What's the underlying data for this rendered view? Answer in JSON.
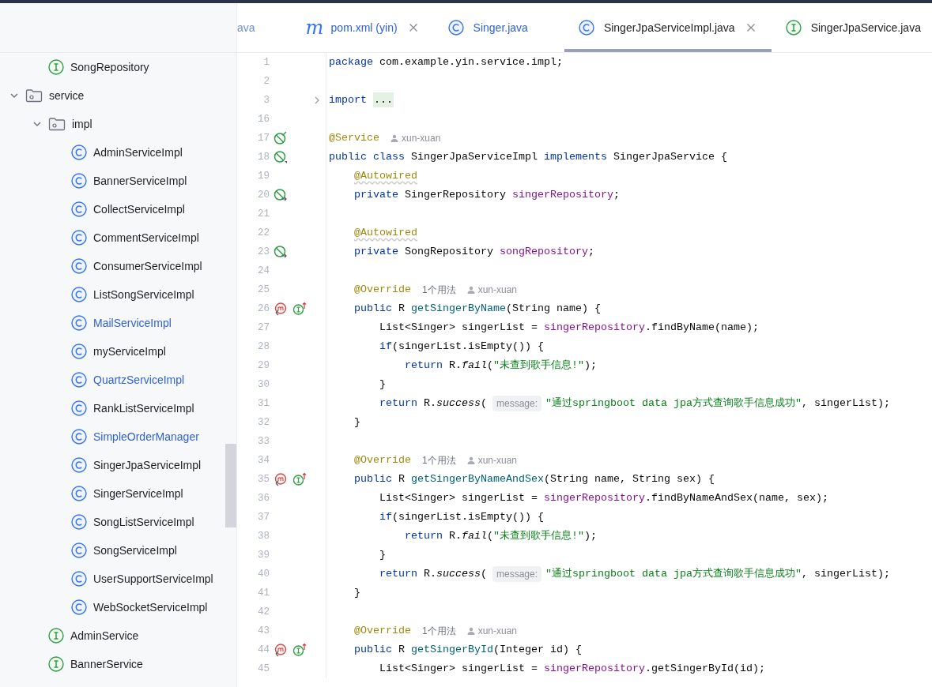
{
  "project_tree": {
    "partial_above": [
      {
        "label": "SongRepository",
        "kind": "interface",
        "modified": false
      }
    ],
    "items": [
      {
        "label": "service",
        "kind": "folder",
        "expanded": true,
        "modified": false,
        "children": [
          {
            "label": "impl",
            "kind": "folder",
            "expanded": true,
            "modified": false,
            "children": [
              {
                "label": "AdminServiceImpl",
                "kind": "class",
                "modified": false
              },
              {
                "label": "BannerServiceImpl",
                "kind": "class",
                "modified": false
              },
              {
                "label": "CollectServiceImpl",
                "kind": "class",
                "modified": false
              },
              {
                "label": "CommentServiceImpl",
                "kind": "class",
                "modified": false
              },
              {
                "label": "ConsumerServiceImpl",
                "kind": "class",
                "modified": false
              },
              {
                "label": "ListSongServiceImpl",
                "kind": "class",
                "modified": false
              },
              {
                "label": "MailServiceImpl",
                "kind": "class",
                "modified": true
              },
              {
                "label": "myServiceImpl",
                "kind": "class",
                "modified": false
              },
              {
                "label": "QuartzServiceImpl",
                "kind": "class",
                "modified": true
              },
              {
                "label": "RankListServiceImpl",
                "kind": "class",
                "modified": false
              },
              {
                "label": "SimpleOrderManager",
                "kind": "class",
                "modified": true
              },
              {
                "label": "SingerJpaServiceImpl",
                "kind": "class",
                "modified": false
              },
              {
                "label": "SingerServiceImpl",
                "kind": "class",
                "modified": false
              },
              {
                "label": "SongListServiceImpl",
                "kind": "class",
                "modified": false
              },
              {
                "label": "SongServiceImpl",
                "kind": "class",
                "modified": false
              },
              {
                "label": "UserSupportServiceImpl",
                "kind": "class",
                "modified": false
              },
              {
                "label": "WebSocketServiceImpl",
                "kind": "class",
                "modified": false
              }
            ]
          },
          {
            "label": "AdminService",
            "kind": "interface",
            "modified": false
          },
          {
            "label": "BannerService",
            "kind": "interface",
            "modified": false
          }
        ]
      }
    ]
  },
  "tabs": [
    {
      "label": "ava",
      "kind": "cut",
      "selected": false,
      "modified": true,
      "closable": false
    },
    {
      "label": "pom.xml (yin)",
      "kind": "maven",
      "glyph": "m",
      "selected": false,
      "modified": true,
      "closable": true
    },
    {
      "label": "Singer.java",
      "kind": "class",
      "selected": false,
      "modified": true,
      "closable": false
    },
    {
      "label": "SingerJpaServiceImpl.java",
      "kind": "class",
      "selected": true,
      "modified": false,
      "closable": true
    },
    {
      "label": "SingerJpaService.java",
      "kind": "interface",
      "selected": false,
      "modified": false,
      "closable": false
    }
  ],
  "editor": {
    "lines": [
      {
        "number": "1",
        "parts": [
          {
            "kind": "code",
            "tokens": [
              {
                "kw": "package"
              },
              {
                "plain": " com.example.yin.service.impl;"
              }
            ]
          }
        ]
      },
      {
        "number": "2"
      },
      {
        "number": "3",
        "fold": {
          "expanded": false
        },
        "parts": [
          {
            "kind": "code",
            "tokens": [
              {
                "kw": "import "
              },
              {
                "folded": "..."
              }
            ]
          }
        ]
      },
      {
        "number": "16"
      },
      {
        "number": "17",
        "markers": [
          {
            "kind": "bean"
          }
        ],
        "parts": [
          {
            "kind": "code",
            "tokens": [
              {
                "ann": "@Service"
              }
            ]
          },
          {
            "kind": "author",
            "text": "xun-xuan"
          }
        ]
      },
      {
        "number": "18",
        "markers": [
          {
            "kind": "bean-class"
          }
        ],
        "parts": [
          {
            "kind": "code",
            "tokens": [
              {
                "kw": "public class"
              },
              {
                "plain": " SingerJpaServiceImpl "
              },
              {
                "kw": "implements"
              },
              {
                "plain": " SingerJpaService {"
              }
            ]
          }
        ]
      },
      {
        "number": "19",
        "parts": [
          {
            "kind": "code",
            "tokens": [
              {
                "ann_warn": "    @Autowired"
              }
            ]
          }
        ]
      },
      {
        "number": "20",
        "markers": [
          {
            "kind": "inject"
          }
        ],
        "parts": [
          {
            "kind": "code",
            "tokens": [
              {
                "kw": "    private"
              },
              {
                "plain": " SingerRepository "
              },
              {
                "field": "singerRepository"
              },
              {
                "plain": ";"
              }
            ]
          }
        ]
      },
      {
        "number": "21"
      },
      {
        "number": "22",
        "parts": [
          {
            "kind": "code",
            "tokens": [
              {
                "ann_warn": "    @Autowired"
              }
            ]
          }
        ]
      },
      {
        "number": "23",
        "markers": [
          {
            "kind": "inject"
          }
        ],
        "parts": [
          {
            "kind": "code",
            "tokens": [
              {
                "kw": "    private"
              },
              {
                "plain": " SongRepository "
              },
              {
                "field": "songRepository"
              },
              {
                "plain": ";"
              }
            ]
          }
        ]
      },
      {
        "number": "24"
      },
      {
        "number": "25",
        "parts": [
          {
            "kind": "code",
            "tokens": [
              {
                "ann": "    @Override"
              }
            ]
          },
          {
            "kind": "usages",
            "text": "1个用法"
          },
          {
            "kind": "author",
            "text": "xun-xuan"
          }
        ]
      },
      {
        "number": "26",
        "markers": [
          {
            "kind": "method"
          },
          {
            "kind": "implements"
          }
        ],
        "parts": [
          {
            "kind": "code",
            "tokens": [
              {
                "kw": "    public"
              },
              {
                "plain": " R "
              },
              {
                "decl": "getSingerByName"
              },
              {
                "plain": "(String name) {"
              }
            ]
          }
        ]
      },
      {
        "number": "27",
        "parts": [
          {
            "kind": "code",
            "tokens": [
              {
                "plain": "        List<Singer> singerList = "
              },
              {
                "field": "singerRepository"
              },
              {
                "plain": ".findByName(name);"
              }
            ]
          }
        ]
      },
      {
        "number": "28",
        "parts": [
          {
            "kind": "code",
            "tokens": [
              {
                "kw": "        if"
              },
              {
                "plain": "(singerList.isEmpty()) {"
              }
            ]
          }
        ]
      },
      {
        "number": "29",
        "parts": [
          {
            "kind": "code",
            "tokens": [
              {
                "kw": "            return"
              },
              {
                "plain": " R."
              },
              {
                "static": "fail"
              },
              {
                "plain": "("
              },
              {
                "str": "\"未查到歌手信息!\""
              },
              {
                "plain": ");"
              }
            ]
          }
        ]
      },
      {
        "number": "30",
        "parts": [
          {
            "kind": "code",
            "tokens": [
              {
                "plain": "        }"
              }
            ]
          }
        ]
      },
      {
        "number": "31",
        "parts": [
          {
            "kind": "code",
            "tokens": [
              {
                "kw": "        return"
              },
              {
                "plain": " R."
              },
              {
                "static": "success"
              },
              {
                "plain": "("
              }
            ]
          },
          {
            "kind": "hint",
            "text": "message:"
          },
          {
            "kind": "code",
            "tokens": [
              {
                "str": "\"通过springboot data jpa方式查询歌手信息成功\""
              },
              {
                "plain": ", singerList);"
              }
            ]
          }
        ]
      },
      {
        "number": "32",
        "parts": [
          {
            "kind": "code",
            "tokens": [
              {
                "plain": "    }"
              }
            ]
          }
        ]
      },
      {
        "number": "33"
      },
      {
        "number": "34",
        "parts": [
          {
            "kind": "code",
            "tokens": [
              {
                "ann": "    @Override"
              }
            ]
          },
          {
            "kind": "usages",
            "text": "1个用法"
          },
          {
            "kind": "author",
            "text": "xun-xuan"
          }
        ]
      },
      {
        "number": "35",
        "markers": [
          {
            "kind": "method"
          },
          {
            "kind": "implements"
          }
        ],
        "parts": [
          {
            "kind": "code",
            "tokens": [
              {
                "kw": "    public"
              },
              {
                "plain": " R "
              },
              {
                "decl": "getSingerByNameAndSex"
              },
              {
                "plain": "(String name, String sex) {"
              }
            ]
          }
        ]
      },
      {
        "number": "36",
        "parts": [
          {
            "kind": "code",
            "tokens": [
              {
                "plain": "        List<Singer> singerList = "
              },
              {
                "field": "singerRepository"
              },
              {
                "plain": ".findByNameAndSex(name, sex);"
              }
            ]
          }
        ]
      },
      {
        "number": "37",
        "parts": [
          {
            "kind": "code",
            "tokens": [
              {
                "kw": "        if"
              },
              {
                "plain": "(singerList.isEmpty()) {"
              }
            ]
          }
        ]
      },
      {
        "number": "38",
        "parts": [
          {
            "kind": "code",
            "tokens": [
              {
                "kw": "            return"
              },
              {
                "plain": " R."
              },
              {
                "static": "fail"
              },
              {
                "plain": "("
              },
              {
                "str": "\"未查到歌手信息!\""
              },
              {
                "plain": ");"
              }
            ]
          }
        ]
      },
      {
        "number": "39",
        "parts": [
          {
            "kind": "code",
            "tokens": [
              {
                "plain": "        }"
              }
            ]
          }
        ]
      },
      {
        "number": "40",
        "parts": [
          {
            "kind": "code",
            "tokens": [
              {
                "kw": "        return"
              },
              {
                "plain": " R."
              },
              {
                "static": "success"
              },
              {
                "plain": "("
              }
            ]
          },
          {
            "kind": "hint",
            "text": "message:"
          },
          {
            "kind": "code",
            "tokens": [
              {
                "str": "\"通过springboot data jpa方式查询歌手信息成功\""
              },
              {
                "plain": ", singerList);"
              }
            ]
          }
        ]
      },
      {
        "number": "41",
        "parts": [
          {
            "kind": "code",
            "tokens": [
              {
                "plain": "    }"
              }
            ]
          }
        ]
      },
      {
        "number": "42"
      },
      {
        "number": "43",
        "parts": [
          {
            "kind": "code",
            "tokens": [
              {
                "ann": "    @Override"
              }
            ]
          },
          {
            "kind": "usages",
            "text": "1个用法"
          },
          {
            "kind": "author",
            "text": "xun-xuan"
          }
        ]
      },
      {
        "number": "44",
        "markers": [
          {
            "kind": "method"
          },
          {
            "kind": "implements"
          }
        ],
        "parts": [
          {
            "kind": "code",
            "tokens": [
              {
                "kw": "    public"
              },
              {
                "plain": " R "
              },
              {
                "decl": "getSingerById"
              },
              {
                "plain": "(Integer id) {"
              }
            ]
          }
        ]
      },
      {
        "number": "45",
        "parts": [
          {
            "kind": "code",
            "tokens": [
              {
                "plain": "        List<Singer> singerList = "
              },
              {
                "field": "singerRepository"
              },
              {
                "plain": ".getSingerById(id);"
              }
            ]
          }
        ]
      }
    ]
  }
}
